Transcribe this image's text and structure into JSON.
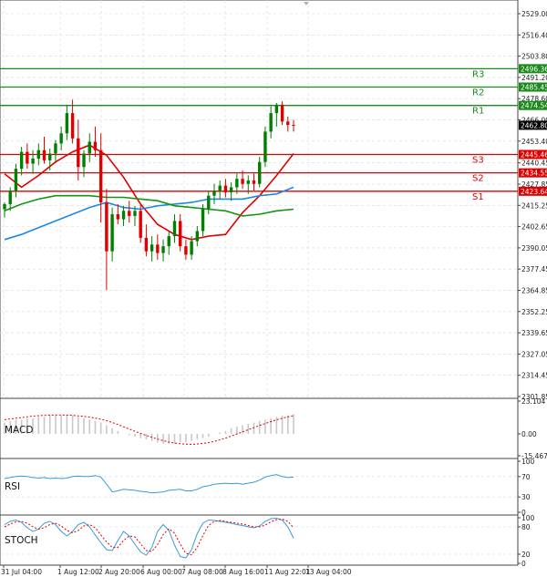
{
  "colors": {
    "up": "#008000",
    "down": "#e00000",
    "resistance": "#1a8a1a",
    "support": "#e00000",
    "ma_red": "#e00000",
    "ma_blue": "#1e88e5",
    "ma_green": "#139413",
    "grid": "#d8d8d8",
    "macd_hist": "#c8c8c8",
    "indicator_line": "#3a9ad9",
    "stoch_signal": "#e00000"
  },
  "chart_data": [
    {
      "type": "candlestick",
      "title": "",
      "ylim": [
        2301.85,
        2529.0
      ],
      "y_ticks": [
        "2529.00",
        "2516.40",
        "2503.80",
        "2491.20",
        "2478.60",
        "2466.00",
        "2453.40",
        "2440.45",
        "2427.85",
        "2415.25",
        "2402.65",
        "2390.05",
        "2377.45",
        "2364.85",
        "2352.25",
        "2339.65",
        "2327.05",
        "2314.45",
        "2301.85"
      ],
      "x_labels": [
        "31 Jul 04:00",
        "1 Aug 12:00",
        "2 Aug 20:00",
        "6 Aug 00:00",
        "7 Aug 08:00",
        "8 Aug 16:00",
        "11 Aug 22:01",
        "13 Aug 04:00"
      ],
      "last_price": "2462.80",
      "levels": [
        {
          "name": "R3",
          "value": 2496.36,
          "label": "2496.36",
          "kind": "resistance"
        },
        {
          "name": "R2",
          "value": 2485.45,
          "label": "2485.45",
          "kind": "resistance"
        },
        {
          "name": "R1",
          "value": 2474.54,
          "label": "2474.54",
          "kind": "resistance"
        },
        {
          "name": "S3",
          "value": 2445.46,
          "label": "2445.46",
          "kind": "support"
        },
        {
          "name": "S2",
          "value": 2434.55,
          "label": "2434.55",
          "kind": "support"
        },
        {
          "name": "S1",
          "value": 2423.64,
          "label": "2423.64",
          "kind": "support"
        }
      ],
      "candles": [
        [
          2413,
          2417,
          2408,
          2416
        ],
        [
          2416,
          2426,
          2412,
          2424
        ],
        [
          2424,
          2440,
          2420,
          2437
        ],
        [
          2437,
          2450,
          2433,
          2447
        ],
        [
          2447,
          2452,
          2437,
          2440
        ],
        [
          2440,
          2448,
          2434,
          2443
        ],
        [
          2443,
          2452,
          2439,
          2448
        ],
        [
          2448,
          2456,
          2440,
          2442
        ],
        [
          2442,
          2449,
          2436,
          2446
        ],
        [
          2446,
          2454,
          2441,
          2452
        ],
        [
          2452,
          2462,
          2448,
          2458
        ],
        [
          2458,
          2475,
          2454,
          2470
        ],
        [
          2470,
          2478,
          2452,
          2455
        ],
        [
          2455,
          2466,
          2430,
          2438
        ],
        [
          2438,
          2448,
          2432,
          2446
        ],
        [
          2446,
          2458,
          2441,
          2453
        ],
        [
          2453,
          2462,
          2444,
          2448
        ],
        [
          2448,
          2458,
          2405,
          2417
        ],
        [
          2417,
          2425,
          2365,
          2388
        ],
        [
          2388,
          2414,
          2382,
          2410
        ],
        [
          2410,
          2416,
          2404,
          2407
        ],
        [
          2407,
          2415,
          2403,
          2412
        ],
        [
          2412,
          2418,
          2405,
          2409
        ],
        [
          2409,
          2415,
          2403,
          2412
        ],
        [
          2412,
          2416,
          2393,
          2396
        ],
        [
          2396,
          2404,
          2385,
          2388
        ],
        [
          2388,
          2397,
          2382,
          2392
        ],
        [
          2392,
          2398,
          2383,
          2387
        ],
        [
          2387,
          2395,
          2382,
          2391
        ],
        [
          2391,
          2400,
          2386,
          2397
        ],
        [
          2397,
          2410,
          2393,
          2406
        ],
        [
          2406,
          2410,
          2388,
          2391
        ],
        [
          2391,
          2395,
          2383,
          2386
        ],
        [
          2386,
          2397,
          2383,
          2394
        ],
        [
          2394,
          2403,
          2391,
          2400
        ],
        [
          2400,
          2416,
          2397,
          2413
        ],
        [
          2413,
          2424,
          2410,
          2421
        ],
        [
          2421,
          2428,
          2416,
          2424
        ],
        [
          2424,
          2430,
          2419,
          2427
        ],
        [
          2427,
          2431,
          2420,
          2423
        ],
        [
          2423,
          2429,
          2418,
          2426
        ],
        [
          2426,
          2434,
          2422,
          2431
        ],
        [
          2431,
          2436,
          2425,
          2428
        ],
        [
          2428,
          2433,
          2422,
          2430
        ],
        [
          2430,
          2434,
          2424,
          2428
        ],
        [
          2428,
          2444,
          2426,
          2441
        ],
        [
          2441,
          2462,
          2438,
          2459
        ],
        [
          2459,
          2474,
          2455,
          2470
        ],
        [
          2470,
          2476,
          2462,
          2475
        ],
        [
          2475,
          2477,
          2463,
          2465
        ],
        [
          2465,
          2468,
          2459,
          2463
        ],
        [
          2463,
          2466,
          2459,
          2462.8
        ]
      ],
      "moving_averages": [
        {
          "color": "ma_red",
          "values": [
            2434,
            2426,
            2433,
            2441,
            2447,
            2451,
            2445,
            2432,
            2416,
            2404,
            2398,
            2395,
            2397,
            2398,
            2411,
            2421,
            2433,
            2446
          ]
        },
        {
          "color": "ma_blue",
          "values": [
            2395,
            2398,
            2402,
            2406,
            2410,
            2414,
            2417,
            2414,
            2413,
            2415,
            2416,
            2417,
            2419,
            2419,
            2419,
            2421,
            2422,
            2426
          ]
        },
        {
          "color": "ma_green",
          "values": [
            2412,
            2416,
            2419,
            2421,
            2421,
            2421,
            2420,
            2420,
            2419,
            2418,
            2415,
            2414,
            2413,
            2412,
            2409,
            2410,
            2412,
            2413
          ]
        }
      ]
    },
    {
      "type": "histogram-line",
      "label": "MACD",
      "y_ticks": [
        "23.104",
        "0.00",
        "-15.467"
      ],
      "ylim": [
        -15.467,
        23.104
      ],
      "histogram": [
        8,
        9,
        10,
        10,
        11,
        11,
        12,
        12,
        13,
        13,
        13,
        13,
        13,
        12,
        11,
        10,
        9,
        8,
        6,
        4,
        2,
        0,
        -1,
        -2,
        -3,
        -4,
        -5,
        -6,
        -7,
        -7,
        -7,
        -6,
        -6,
        -5,
        -4,
        -3,
        -2,
        0,
        1,
        2,
        4,
        5,
        6,
        7,
        8,
        9,
        10,
        11,
        12,
        13,
        13,
        14
      ],
      "signal": [
        10,
        10.5,
        11,
        11.5,
        12,
        12.5,
        12.8,
        13,
        13.2,
        13.3,
        13.3,
        13.2,
        13,
        12.7,
        12.3,
        11.8,
        11.1,
        10.3,
        9.3,
        8,
        6.6,
        5,
        3.4,
        1.8,
        0.3,
        -1.2,
        -2.5,
        -3.7,
        -4.8,
        -5.8,
        -6.5,
        -7,
        -7.3,
        -7.4,
        -7.2,
        -6.8,
        -6.2,
        -5.3,
        -4.2,
        -3,
        -1.6,
        -0.1,
        1.4,
        2.9,
        4.4,
        5.9,
        7.3,
        8.6,
        9.9,
        11,
        12,
        12.8
      ]
    },
    {
      "type": "line",
      "label": "RSI",
      "y_ticks": [
        "100",
        "70",
        "30",
        "0"
      ],
      "ylim": [
        0,
        100
      ],
      "values": [
        66,
        68,
        70,
        71,
        70,
        68,
        67,
        68,
        66,
        67,
        66,
        67,
        70,
        71,
        70,
        70,
        72,
        69,
        55,
        40,
        42,
        45,
        44,
        43,
        41,
        40,
        38,
        39,
        40,
        43,
        44,
        45,
        42,
        42,
        45,
        50,
        52,
        55,
        56,
        57,
        56,
        57,
        55,
        57,
        59,
        63,
        69,
        72,
        74,
        70,
        68,
        69
      ]
    },
    {
      "type": "line",
      "label": "STOCH",
      "y_ticks": [
        "100",
        "80",
        "20",
        "0"
      ],
      "ylim": [
        0,
        100
      ],
      "k": [
        85,
        92,
        95,
        90,
        78,
        70,
        75,
        88,
        92,
        85,
        70,
        60,
        70,
        85,
        90,
        80,
        62,
        45,
        30,
        28,
        50,
        70,
        60,
        42,
        25,
        18,
        35,
        70,
        85,
        72,
        40,
        15,
        12,
        30,
        65,
        88,
        95,
        94,
        92,
        90,
        88,
        85,
        83,
        80,
        78,
        82,
        92,
        98,
        99,
        95,
        80,
        55
      ],
      "d": [
        80,
        86,
        91,
        92,
        88,
        80,
        75,
        78,
        85,
        88,
        82,
        72,
        67,
        72,
        82,
        85,
        78,
        62,
        47,
        35,
        35,
        50,
        60,
        58,
        43,
        28,
        26,
        41,
        63,
        76,
        66,
        42,
        22,
        19,
        35,
        61,
        83,
        92,
        94,
        92,
        90,
        88,
        86,
        83,
        80,
        80,
        84,
        91,
        96,
        97,
        92,
        78
      ]
    }
  ]
}
